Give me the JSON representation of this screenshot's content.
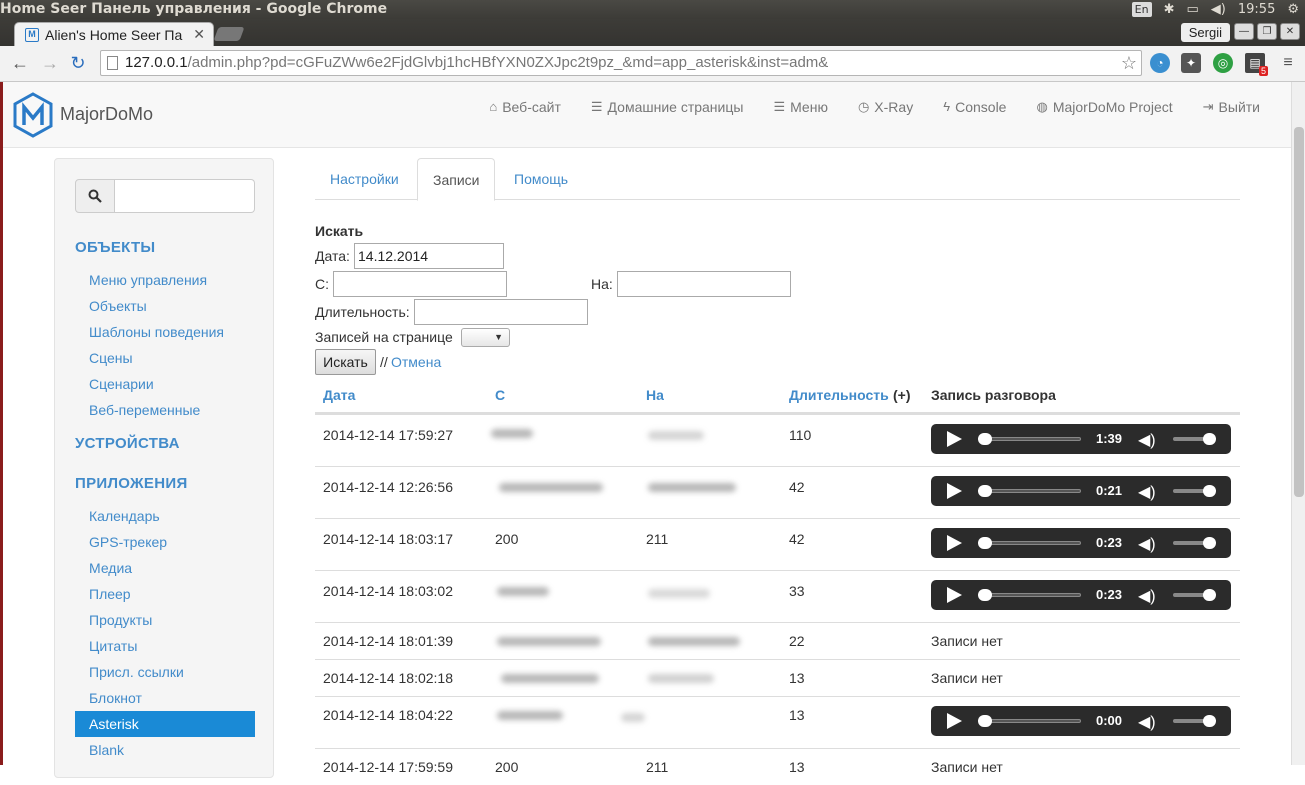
{
  "os": {
    "window_title": "Home Seer Панель управления - Google Chrome",
    "lang": "En",
    "clock": "19:55"
  },
  "browser": {
    "tab_title": "Alien's Home Seer Па",
    "profile": "Sergii",
    "url_host": "127.0.0.1",
    "url_path": "/admin.php?pd=cGFuZWw6e2FjdGlvbj1hcHBfYXN0ZXJpc2t9pz_&md=app_asterisk&inst=adm&",
    "ext_badge": "5"
  },
  "navbar": {
    "brand": "MajorDoMo",
    "items": [
      {
        "label": "Веб-сайт",
        "icon": "home-icon"
      },
      {
        "label": "Домашние страницы",
        "icon": "list-icon"
      },
      {
        "label": "Меню",
        "icon": "list-icon"
      },
      {
        "label": "X-Ray",
        "icon": "clock-icon"
      },
      {
        "label": "Console",
        "icon": "bolt-icon"
      },
      {
        "label": "MajorDoMo Project",
        "icon": "globe-icon"
      },
      {
        "label": "Выйти",
        "icon": "logout-icon"
      }
    ]
  },
  "sidebar": {
    "search_placeholder": "",
    "sections": [
      {
        "title": "ОБЪЕКТЫ"
      },
      {
        "title": "УСТРОЙСТВА"
      },
      {
        "title": "ПРИЛОЖЕНИЯ"
      }
    ],
    "objects_items": [
      "Меню управления",
      "Объекты",
      "Шаблоны поведения",
      "Сцены",
      "Сценарии",
      "Веб-переменные"
    ],
    "apps_items": [
      "Календарь",
      "GPS-трекер",
      "Медиа",
      "Плеер",
      "Продукты",
      "Цитаты",
      "Присл. ссылки",
      "Блокнот",
      "Asterisk",
      "Blank"
    ],
    "active_item": "Asterisk"
  },
  "tabs": [
    "Настройки",
    "Записи",
    "Помощь"
  ],
  "active_tab": "Записи",
  "search_form": {
    "title": "Искать",
    "date_label": "Дата:",
    "date_value": "14.12.2014",
    "from_label": "С:",
    "from_value": "",
    "to_label": "На:",
    "to_value": "",
    "duration_label": "Длительность:",
    "duration_value": "",
    "per_page_label": "Записей на странице",
    "per_page_value": "",
    "submit_label": "Искать",
    "separator": "//",
    "cancel_label": "Отмена"
  },
  "table": {
    "headers": {
      "date": "Дата",
      "from": "С",
      "to": "На",
      "duration": "Длительность",
      "duration_extra": "(+)",
      "recording": "Запись разговора"
    },
    "no_record_text": "Записи нет",
    "rows": [
      {
        "date": "2014-12-14 17:59:27",
        "from": "",
        "to": "",
        "duration": "110",
        "player_time": "1:39"
      },
      {
        "date": "2014-12-14 12:26:56",
        "from": "",
        "to": "",
        "duration": "42",
        "player_time": "0:21"
      },
      {
        "date": "2014-12-14 18:03:17",
        "from": "200",
        "to": "211",
        "duration": "42",
        "player_time": "0:23"
      },
      {
        "date": "2014-12-14 18:03:02",
        "from": "",
        "to": "",
        "duration": "33",
        "player_time": "0:23"
      },
      {
        "date": "2014-12-14 18:01:39",
        "from": "",
        "to": "",
        "duration": "22",
        "player_time": null
      },
      {
        "date": "2014-12-14 18:02:18",
        "from": "",
        "to": "",
        "duration": "13",
        "player_time": null
      },
      {
        "date": "2014-12-14 18:04:22",
        "from": "",
        "to": "",
        "duration": "13",
        "player_time": "0:00"
      },
      {
        "date": "2014-12-14 17:59:59",
        "from": "200",
        "to": "211",
        "duration": "13",
        "player_time": null
      }
    ]
  }
}
